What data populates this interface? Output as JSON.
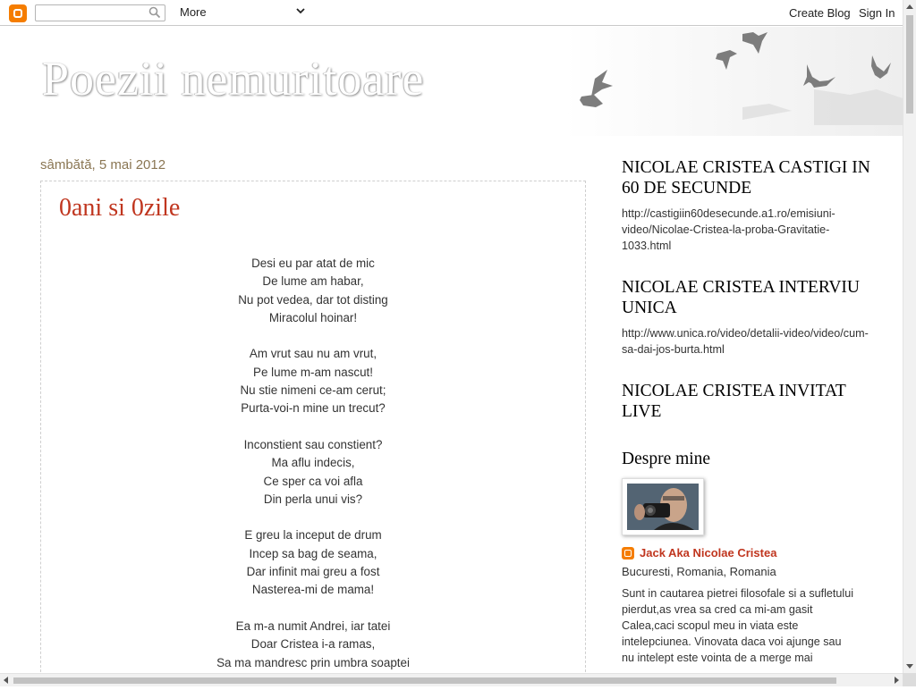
{
  "navbar": {
    "search_placeholder": "",
    "more_label": "More",
    "create_blog": "Create Blog",
    "sign_in": "Sign In"
  },
  "header": {
    "blog_title": "Poezii nemuritoare"
  },
  "post": {
    "date": "sâmbătă, 5 mai 2012",
    "title": "0ani si 0zile",
    "stanzas": [
      [
        "Desi eu par atat de mic",
        "De lume am habar,",
        "Nu pot vedea, dar tot disting",
        "Miracolul hoinar!"
      ],
      [
        "Am vrut sau nu am vrut,",
        "Pe lume m-am nascut!",
        "Nu stie nimeni ce-am cerut;",
        "Purta-voi-n mine un trecut?"
      ],
      [
        "Inconstient sau constient?",
        "Ma aflu indecis,",
        "Ce sper ca voi afla",
        "Din perla unui vis?"
      ],
      [
        "E greu la inceput de drum",
        "Incep sa bag de seama,",
        "Dar infinit mai greu a fost",
        "Nasterea-mi de mama!"
      ],
      [
        "Ea m-a numit Andrei, iar tatei",
        "Doar Cristea i-a ramas,",
        "Sa ma mandresc prin umbra soaptei"
      ]
    ]
  },
  "sidebar": {
    "widgets": [
      {
        "title": "NICOLAE CRISTEA CASTIGI IN 60 DE SECUNDE",
        "text": "http://castigiin60desecunde.a1.ro/emisiuni-video/Nicolae-Cristea-la-proba-Gravitatie-1033.html"
      },
      {
        "title": "NICOLAE CRISTEA INTERVIU UNICA",
        "text": "http://www.unica.ro/video/detalii-video/video/cum-sa-dai-jos-burta.html"
      },
      {
        "title": "NICOLAE CRISTEA INVITAT LIVE",
        "text": ""
      }
    ],
    "about": {
      "title": "Despre mine",
      "name": "Jack Aka Nicolae Cristea",
      "location": "Bucuresti, Romania, Romania",
      "description": "Sunt in cautarea pietrei filosofale si a sufletului pierdut,as vrea sa cred ca mi-am gasit Calea,caci scopul meu in viata este intelepciunea. Vinovata daca voi ajunge sau nu intelept este vointa de a merge mai"
    }
  },
  "colors": {
    "accent": "#c0361f",
    "date": "#8a7653",
    "blogger_orange": "#f57d00"
  }
}
